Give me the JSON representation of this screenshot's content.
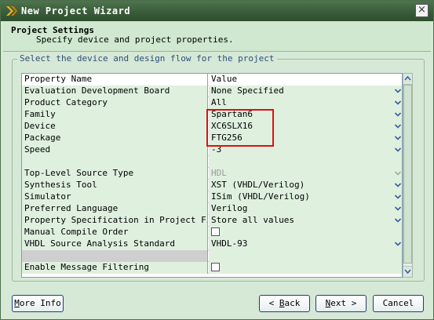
{
  "window": {
    "title": "New Project Wizard",
    "close_glyph": "×"
  },
  "header": {
    "title": "Project Settings",
    "subtitle": "Specify device and project properties."
  },
  "group": {
    "title": "Select the device and design flow for the project"
  },
  "table": {
    "columns": [
      "Property Name",
      "Value"
    ],
    "rows": [
      {
        "name": "Evaluation Development Board",
        "value": "None Specified",
        "type": "dropdown"
      },
      {
        "name": "Product Category",
        "value": "All",
        "type": "dropdown"
      },
      {
        "name": "Family",
        "value": "Spartan6",
        "type": "dropdown"
      },
      {
        "name": "Device",
        "value": "XC6SLX16",
        "type": "dropdown"
      },
      {
        "name": "Package",
        "value": "FTG256",
        "type": "dropdown"
      },
      {
        "name": "Speed",
        "value": "-3",
        "type": "dropdown"
      },
      {
        "name": "",
        "value": "",
        "type": "blank"
      },
      {
        "name": "Top-Level Source Type",
        "value": "HDL",
        "type": "dropdown-disabled"
      },
      {
        "name": "Synthesis Tool",
        "value": "XST (VHDL/Verilog)",
        "type": "dropdown"
      },
      {
        "name": "Simulator",
        "value": "ISim (VHDL/Verilog)",
        "type": "dropdown"
      },
      {
        "name": "Preferred Language",
        "value": "Verilog",
        "type": "dropdown"
      },
      {
        "name": "Property Specification in Project File",
        "value": "Store all values",
        "type": "dropdown"
      },
      {
        "name": "Manual Compile Order",
        "value": "",
        "type": "checkbox"
      },
      {
        "name": "VHDL Source Analysis Standard",
        "value": "VHDL-93",
        "type": "dropdown"
      },
      {
        "name": "",
        "value": "",
        "type": "gray"
      },
      {
        "name": "Enable Message Filtering",
        "value": "",
        "type": "checkbox"
      }
    ]
  },
  "buttons": {
    "more_info": {
      "pre": "",
      "ul": "M",
      "post": "ore Info"
    },
    "back": {
      "pre": "< ",
      "ul": "B",
      "post": "ack"
    },
    "next": {
      "pre": "",
      "ul": "N",
      "post": "ext >"
    },
    "cancel": {
      "pre": "",
      "ul": "",
      "post": "Cancel"
    }
  },
  "colors": {
    "highlight": "#dd1111",
    "row_bg": "#dff0df",
    "title_bar": "#3a5c3a"
  }
}
